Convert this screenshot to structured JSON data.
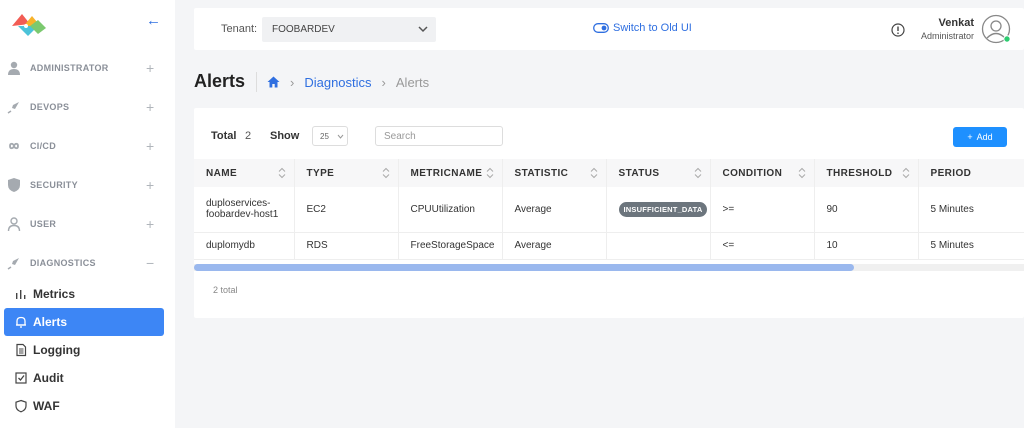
{
  "sidebar": {
    "sections": [
      {
        "label": "ADMINISTRATOR",
        "toggle": "+"
      },
      {
        "label": "DEVOPS",
        "toggle": "+"
      },
      {
        "label": "CI/CD",
        "toggle": "+"
      },
      {
        "label": "SECURITY",
        "toggle": "+"
      },
      {
        "label": "USER",
        "toggle": "+"
      },
      {
        "label": "DIAGNOSTICS",
        "toggle": "−"
      }
    ],
    "subitems": [
      {
        "label": "Metrics",
        "icon": "bar-chart-icon"
      },
      {
        "label": "Alerts",
        "icon": "bell-icon",
        "active": true
      },
      {
        "label": "Logging",
        "icon": "document-icon"
      },
      {
        "label": "Audit",
        "icon": "checkbox-icon"
      },
      {
        "label": "WAF",
        "icon": "shield-icon"
      }
    ]
  },
  "topbar": {
    "tenant_label": "Tenant:",
    "tenant_value": "FOOBARDEV",
    "switch_label": "Switch to Old UI",
    "user_name": "Venkat",
    "user_role": "Administrator"
  },
  "page": {
    "title": "Alerts",
    "breadcrumb": [
      "Diagnostics",
      "Alerts"
    ]
  },
  "toolbar": {
    "total_label": "Total",
    "total_value": "2",
    "show_label": "Show",
    "show_value": "25",
    "search_placeholder": "Search",
    "add_label": "Add"
  },
  "table": {
    "columns": [
      "NAME",
      "TYPE",
      "METRICNAME",
      "STATISTIC",
      "STATUS",
      "CONDITION",
      "THRESHOLD",
      "PERIOD"
    ],
    "rows": [
      {
        "name": "duploservices-foobardev-host1",
        "type": "EC2",
        "metric": "CPUUtilization",
        "statistic": "Average",
        "status": "INSUFFICIENT_DATA",
        "condition": ">=",
        "threshold": "90",
        "period": "5 Minutes"
      },
      {
        "name": "duplomydb",
        "type": "RDS",
        "metric": "FreeStorageSpace",
        "statistic": "Average",
        "status": "",
        "condition": "<=",
        "threshold": "10",
        "period": "5 Minutes"
      }
    ],
    "scroll_position": 0.0,
    "footer": "2 total"
  },
  "colors": {
    "accent": "#2f6fe0",
    "active_nav": "#3d86f5",
    "add_button": "#1e90ff",
    "status_badge": "#6c757d"
  }
}
